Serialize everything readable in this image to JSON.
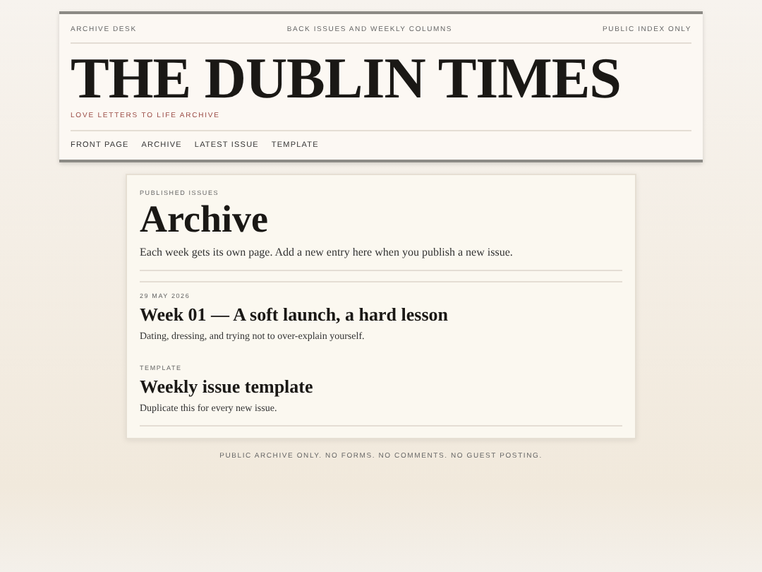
{
  "masthead": {
    "top_left": "ARCHIVE DESK",
    "top_center": "BACK ISSUES AND WEEKLY COLUMNS",
    "top_right": "PUBLIC INDEX ONLY",
    "title": "THE DUBLIN TIMES",
    "tagline": "LOVE LETTERS TO LIFE ARCHIVE",
    "nav": [
      "FRONT PAGE",
      "ARCHIVE",
      "LATEST ISSUE",
      "TEMPLATE"
    ]
  },
  "archive": {
    "eyebrow": "PUBLISHED ISSUES",
    "heading": "Archive",
    "intro": "Each week gets its own page. Add a new entry here when you publish a new issue.",
    "entries": [
      {
        "label": "29 MAY 2026",
        "title": "Week 01 — A soft launch, a hard lesson",
        "summary": "Dating, dressing, and trying not to over-explain yourself."
      },
      {
        "label": "TEMPLATE",
        "title": "Weekly issue template",
        "summary": "Duplicate this for every new issue."
      }
    ]
  },
  "footer": "PUBLIC ARCHIVE ONLY. NO FORMS. NO COMMENTS. NO GUEST POSTING."
}
